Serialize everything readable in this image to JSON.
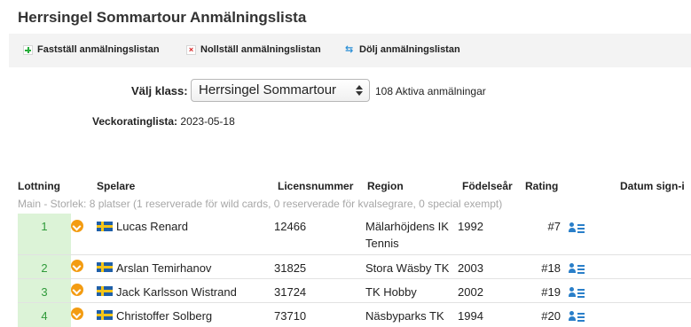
{
  "page": {
    "title": "Herrsingel Sommartour Anmälningslista"
  },
  "toolbar": {
    "items": [
      {
        "label": "Fastställ anmälningslistan",
        "icon": "plus-icon"
      },
      {
        "label": "Nollställ anmälningslistan",
        "icon": "x-icon"
      },
      {
        "label": "Dölj anmälningslistan",
        "icon": "arrows-icon"
      }
    ]
  },
  "filter": {
    "class_label": "Välj klass:",
    "class_value": "Herrsingel Sommartour",
    "active_count": "108 Aktiva anmälningar",
    "ranking_label": "Veckoratinglista:",
    "ranking_date": "2023-05-18"
  },
  "table": {
    "headers": [
      "Lottning",
      "Spelare",
      "Licensnummer",
      "Region",
      "Födelseår",
      "Rating",
      "Datum sign-i"
    ],
    "section_text": "Main - Storlek: 8 platser (1 reserverade för wild cards, 0 reserverade för kvalsegrare, 0 special exempt)",
    "rows": [
      {
        "lot": "1",
        "player": "Lucas Renard",
        "license": "12466",
        "region": "Mälarhöjdens IK",
        "region2": "Tennis",
        "year": "1992",
        "rank": "#7"
      },
      {
        "lot": "2",
        "player": "Arslan Temirhanov",
        "license": "31825",
        "region": "Stora Wäsby TK",
        "region2": "",
        "year": "2003",
        "rank": "#18"
      },
      {
        "lot": "3",
        "player": "Jack Karlsson Wistrand",
        "license": "31724",
        "region": "TK Hobby",
        "region2": "",
        "year": "2002",
        "rank": "#19"
      },
      {
        "lot": "4",
        "player": "Christoffer Solberg",
        "license": "73710",
        "region": "Näsbyparks TK",
        "region2": "",
        "year": "1994",
        "rank": "#20"
      }
    ]
  },
  "colors": {
    "lot_bg": "#dcf3d7",
    "lot_text": "#2f9a3a",
    "dropdown_badge": "#f39c12",
    "player_icon": "#2a7fc9",
    "section_text": "#a7a7a7"
  }
}
